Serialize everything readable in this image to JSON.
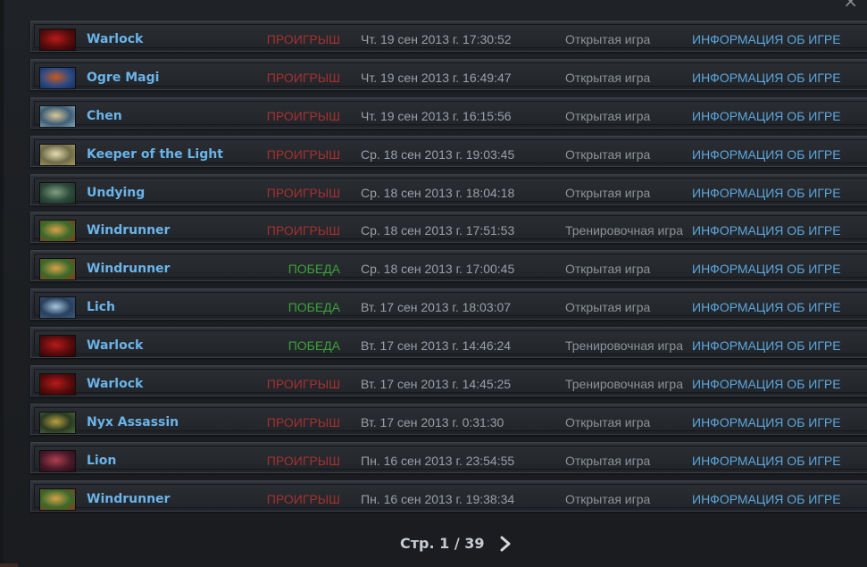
{
  "window": {
    "close_icon": "close-icon"
  },
  "colors": {
    "hero_name": "#6ab4ea",
    "loss": "#a73030",
    "win": "#3aa23a",
    "info_link": "#5ba7de"
  },
  "matches": [
    {
      "hero": "Warlock",
      "portrait": "warlock-portrait-icon",
      "result": "ПРОИГРЫШ",
      "outcome": "loss",
      "date": "Чт. 19 сен 2013 г. 17:30:52",
      "mode": "Открытая игра",
      "info": "ИНФОРМАЦИЯ ОБ ИГРЕ"
    },
    {
      "hero": "Ogre Magi",
      "portrait": "ogre-magi-portrait-icon",
      "result": "ПРОИГРЫШ",
      "outcome": "loss",
      "date": "Чт. 19 сен 2013 г. 16:49:47",
      "mode": "Открытая игра",
      "info": "ИНФОРМАЦИЯ ОБ ИГРЕ"
    },
    {
      "hero": "Chen",
      "portrait": "chen-portrait-icon",
      "result": "ПРОИГРЫШ",
      "outcome": "loss",
      "date": "Чт. 19 сен 2013 г. 16:15:56",
      "mode": "Открытая игра",
      "info": "ИНФОРМАЦИЯ ОБ ИГРЕ"
    },
    {
      "hero": "Keeper of the Light",
      "portrait": "keeper-of-the-light-portrait-icon",
      "result": "ПРОИГРЫШ",
      "outcome": "loss",
      "date": "Ср. 18 сен 2013 г. 19:03:45",
      "mode": "Открытая игра",
      "info": "ИНФОРМАЦИЯ ОБ ИГРЕ"
    },
    {
      "hero": "Undying",
      "portrait": "undying-portrait-icon",
      "result": "ПРОИГРЫШ",
      "outcome": "loss",
      "date": "Ср. 18 сен 2013 г. 18:04:18",
      "mode": "Открытая игра",
      "info": "ИНФОРМАЦИЯ ОБ ИГРЕ"
    },
    {
      "hero": "Windrunner",
      "portrait": "windrunner-portrait-icon",
      "result": "ПРОИГРЫШ",
      "outcome": "loss",
      "date": "Ср. 18 сен 2013 г. 17:51:53",
      "mode": "Тренировочная игра",
      "info": "ИНФОРМАЦИЯ ОБ ИГРЕ"
    },
    {
      "hero": "Windrunner",
      "portrait": "windrunner-portrait-icon",
      "result": "ПОБЕДА",
      "outcome": "win",
      "date": "Ср. 18 сен 2013 г. 17:00:45",
      "mode": "Открытая игра",
      "info": "ИНФОРМАЦИЯ ОБ ИГРЕ"
    },
    {
      "hero": "Lich",
      "portrait": "lich-portrait-icon",
      "result": "ПОБЕДА",
      "outcome": "win",
      "date": "Вт. 17 сен 2013 г. 18:03:07",
      "mode": "Открытая игра",
      "info": "ИНФОРМАЦИЯ ОБ ИГРЕ"
    },
    {
      "hero": "Warlock",
      "portrait": "warlock-portrait-icon",
      "result": "ПОБЕДА",
      "outcome": "win",
      "date": "Вт. 17 сен 2013 г. 14:46:24",
      "mode": "Тренировочная игра",
      "info": "ИНФОРМАЦИЯ ОБ ИГРЕ"
    },
    {
      "hero": "Warlock",
      "portrait": "warlock-portrait-icon",
      "result": "ПРОИГРЫШ",
      "outcome": "loss",
      "date": "Вт. 17 сен 2013 г. 14:45:25",
      "mode": "Тренировочная игра",
      "info": "ИНФОРМАЦИЯ ОБ ИГРЕ"
    },
    {
      "hero": "Nyx Assassin",
      "portrait": "nyx-assassin-portrait-icon",
      "result": "ПРОИГРЫШ",
      "outcome": "loss",
      "date": "Вт. 17 сен 2013 г. 0:31:30",
      "mode": "Открытая игра",
      "info": "ИНФОРМАЦИЯ ОБ ИГРЕ"
    },
    {
      "hero": "Lion",
      "portrait": "lion-portrait-icon",
      "result": "ПРОИГРЫШ",
      "outcome": "loss",
      "date": "Пн. 16 сен 2013 г. 23:54:55",
      "mode": "Открытая игра",
      "info": "ИНФОРМАЦИЯ ОБ ИГРЕ"
    },
    {
      "hero": "Windrunner",
      "portrait": "windrunner-portrait-icon",
      "result": "ПРОИГРЫШ",
      "outcome": "loss",
      "date": "Пн. 16 сен 2013 г. 19:38:34",
      "mode": "Открытая игра",
      "info": "ИНФОРМАЦИЯ ОБ ИГРЕ"
    }
  ],
  "pagination": {
    "label": "Стр. 1 / 39",
    "next_icon": "chevron-right-icon"
  }
}
